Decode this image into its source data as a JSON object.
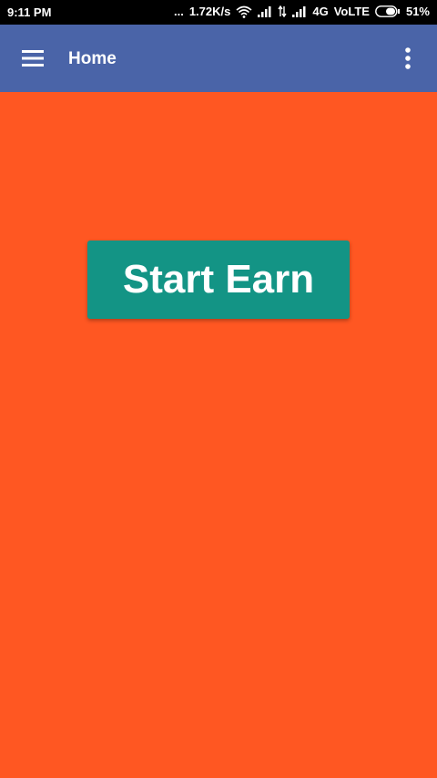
{
  "status_bar": {
    "time": "9:11 PM",
    "network_speed": "1.72K/s",
    "dots": "...",
    "network_type": "4G",
    "volte": "VoLTE",
    "battery": "51%"
  },
  "app_bar": {
    "title": "Home",
    "menu_icon": "hamburger-menu-icon",
    "overflow_icon": "more-vert-icon"
  },
  "main": {
    "start_button_label": "Start Earn"
  },
  "colors": {
    "background": "#FF5722",
    "app_bar": "#4A64A8",
    "button": "#139485",
    "status_bar": "#000000"
  }
}
